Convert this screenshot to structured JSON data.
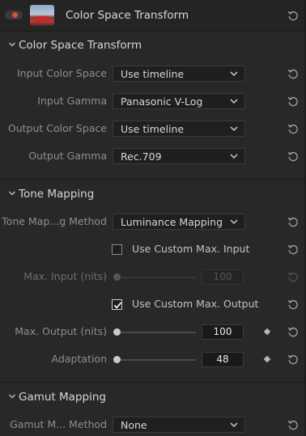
{
  "header": {
    "title": "Color Space Transform"
  },
  "sections": {
    "csc": {
      "title": "Color Space Transform"
    },
    "tone": {
      "title": "Tone Mapping"
    },
    "gamut": {
      "title": "Gamut Mapping"
    }
  },
  "fields": {
    "input_color_space": {
      "label": "Input Color Space",
      "value": "Use timeline"
    },
    "input_gamma": {
      "label": "Input Gamma",
      "value": "Panasonic V-Log"
    },
    "output_color_space": {
      "label": "Output Color Space",
      "value": "Use timeline"
    },
    "output_gamma": {
      "label": "Output Gamma",
      "value": "Rec.709"
    },
    "tone_method": {
      "label": "Tone Map...g Method",
      "value": "Luminance Mapping"
    },
    "use_custom_max_input": {
      "label": "Use Custom Max. Input",
      "checked": false
    },
    "max_input": {
      "label": "Max. Input (nits)",
      "value": "100",
      "enabled": false
    },
    "use_custom_max_output": {
      "label": "Use Custom Max. Output",
      "checked": true
    },
    "max_output": {
      "label": "Max. Output (nits)",
      "value": "100"
    },
    "adaptation": {
      "label": "Adaptation",
      "value": "48"
    },
    "gamut_method": {
      "label": "Gamut M... Method",
      "value": "None"
    }
  },
  "colors": {
    "toggle_dot": "#e2493f",
    "panel_bg": "#282828",
    "header_bg": "#242424"
  },
  "icons": {
    "reset": "reset-icon",
    "chevron": "chevron-down-icon",
    "keyframe": "keyframe-diamond-icon"
  }
}
